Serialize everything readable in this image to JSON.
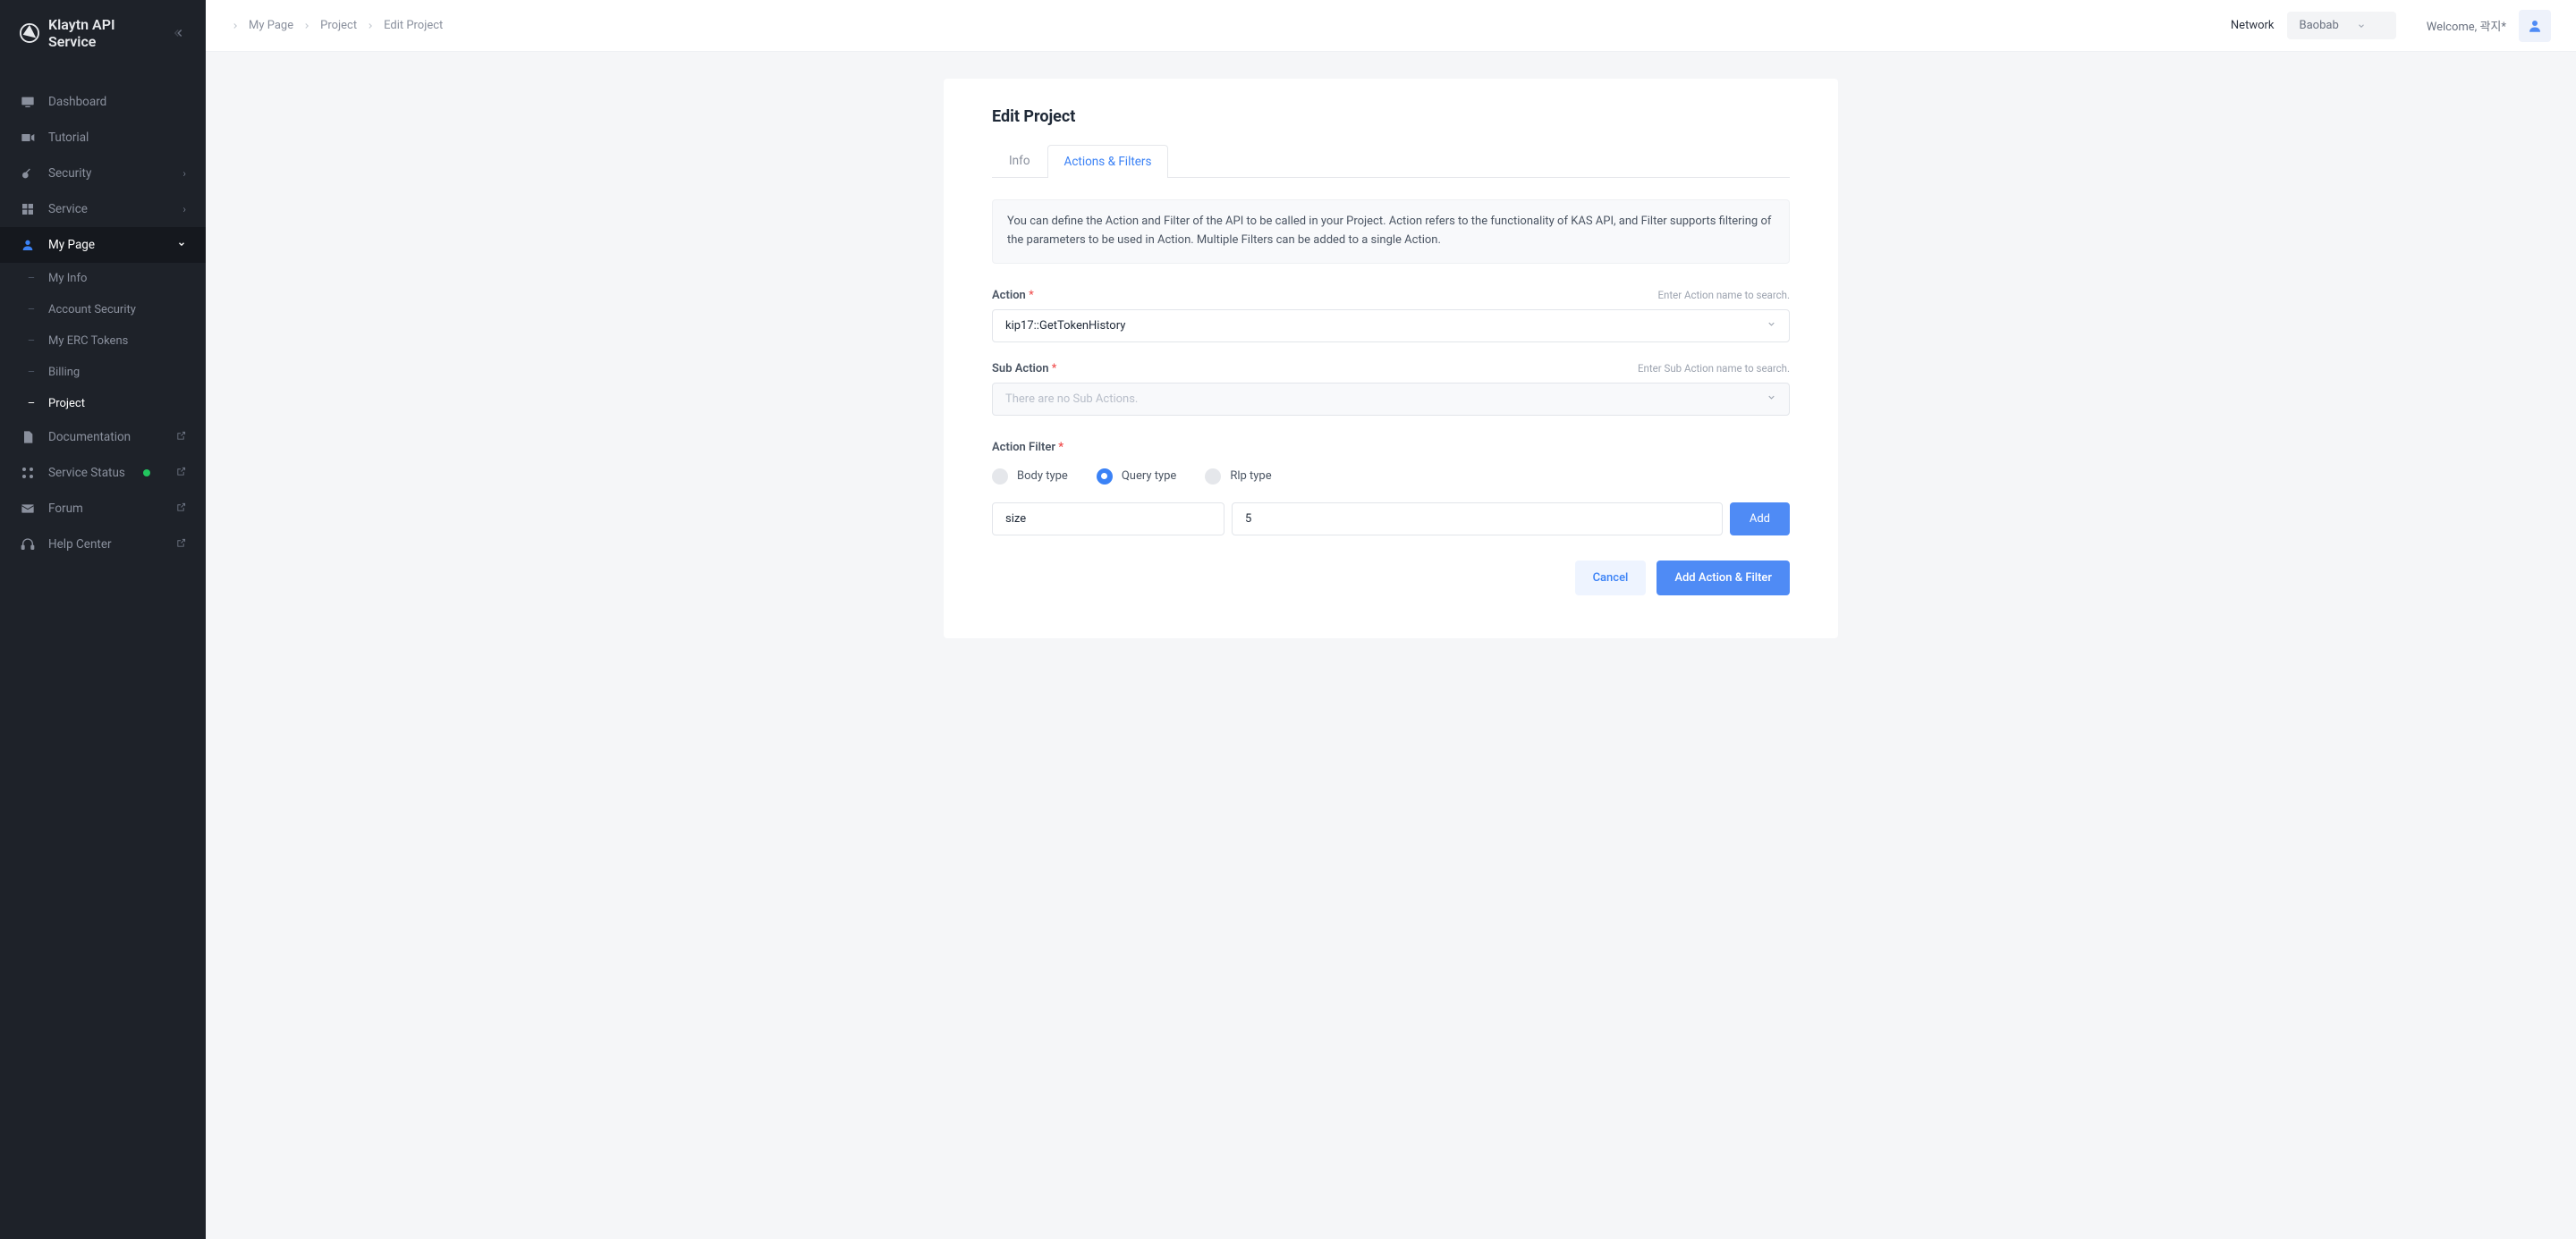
{
  "brand": {
    "title": "Klaytn API Service"
  },
  "sidebar": {
    "items": [
      {
        "label": "Dashboard",
        "icon": "monitor"
      },
      {
        "label": "Tutorial",
        "icon": "video"
      },
      {
        "label": "Security",
        "icon": "key",
        "chev": true
      },
      {
        "label": "Service",
        "icon": "grid",
        "chev": true
      },
      {
        "label": "My Page",
        "icon": "user",
        "chev": true,
        "active": true
      },
      {
        "label": "Documentation",
        "icon": "doc",
        "ext": true
      },
      {
        "label": "Service Status",
        "icon": "status",
        "dot": true,
        "ext": true
      },
      {
        "label": "Forum",
        "icon": "mail",
        "ext": true
      },
      {
        "label": "Help Center",
        "icon": "headset",
        "ext": true
      }
    ],
    "subitems": [
      {
        "label": "My Info"
      },
      {
        "label": "Account Security"
      },
      {
        "label": "My ERC Tokens"
      },
      {
        "label": "Billing"
      },
      {
        "label": "Project",
        "active": true
      }
    ]
  },
  "topbar": {
    "crumbs": [
      "My Page",
      "Project",
      "Edit Project"
    ],
    "network_label": "Network",
    "network_value": "Baobab",
    "welcome_prefix": "Welcome, ",
    "welcome_user": "곽지*"
  },
  "page": {
    "title": "Edit Project",
    "tabs": {
      "info": "Info",
      "actions": "Actions & Filters"
    },
    "notice": "You can define the Action and Filter of the API to be called in your Project. Action refers to the functionality of KAS API, and Filter supports filtering of the parameters to be used in Action. Multiple Filters can be added to a single Action.",
    "action": {
      "label": "Action",
      "hint": "Enter Action name to search.",
      "value": "kip17::GetTokenHistory"
    },
    "subaction": {
      "label": "Sub Action",
      "hint": "Enter Sub Action name to search.",
      "placeholder": "There are no Sub Actions."
    },
    "filter": {
      "label": "Action Filter",
      "options": {
        "body": "Body type",
        "query": "Query type",
        "rlp": "Rlp type"
      },
      "key_value": "size",
      "val_value": "5",
      "add_btn": "Add"
    },
    "buttons": {
      "cancel": "Cancel",
      "submit": "Add Action & Filter"
    }
  }
}
